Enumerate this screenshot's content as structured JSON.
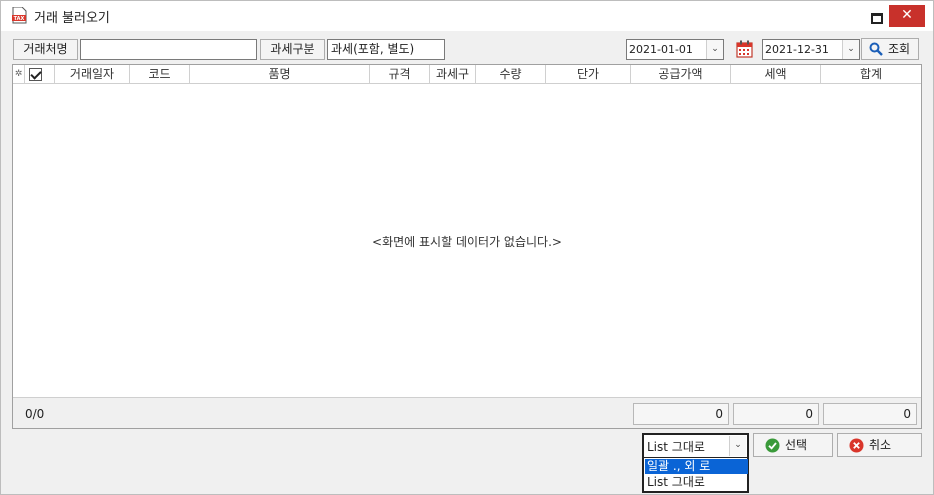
{
  "window": {
    "title": "거래 불러오기",
    "close_glyph": "✕"
  },
  "filter": {
    "partner_label": "거래처명",
    "partner_value": "",
    "tax_label": "과세구분",
    "tax_value": "과세(포함, 별도)",
    "date_from": "2021-01-01",
    "date_to": "2021-12-31",
    "search_label": "조회"
  },
  "grid": {
    "columns": [
      "거래일자",
      "코드",
      "품명",
      "규격",
      "과세구",
      "수량",
      "단가",
      "공급가액",
      "세액",
      "합계"
    ],
    "row_marker": "✲",
    "empty_message": "<화면에 표시할 데이터가 없습니다.>",
    "count": "0/0",
    "totals": [
      "0",
      "0",
      "0"
    ]
  },
  "footer": {
    "select_value": "List 그대로",
    "options": [
      "일괄 ., 외 로",
      "List 그대로"
    ],
    "select_label": "선택",
    "cancel_label": "취소"
  },
  "colors": {
    "close_bg": "#c8312b",
    "highlight": "#0a64d6",
    "accent_green": "#3a9a3a",
    "accent_red": "#d9362b"
  }
}
